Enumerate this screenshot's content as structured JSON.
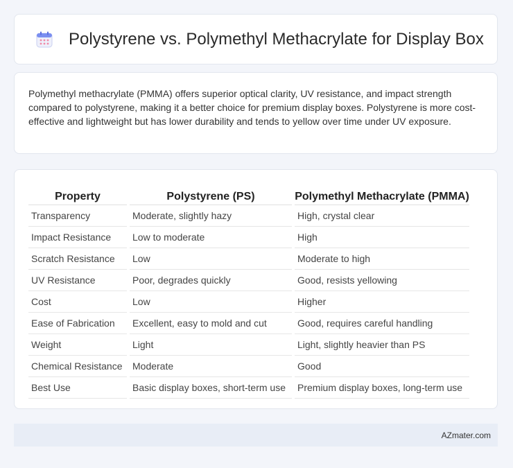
{
  "header": {
    "title": "Polystyrene vs. Polymethyl Methacrylate for Display Box",
    "icon": "calendar-icon"
  },
  "summary": {
    "text": "Polymethyl methacrylate (PMMA) offers superior optical clarity, UV resistance, and impact strength compared to polystyrene, making it a better choice for premium display boxes. Polystyrene is more cost-effective and lightweight but has lower durability and tends to yellow over time under UV exposure."
  },
  "table": {
    "headers": [
      "Property",
      "Polystyrene (PS)",
      "Polymethyl Methacrylate (PMMA)"
    ],
    "rows": [
      [
        "Transparency",
        "Moderate, slightly hazy",
        "High, crystal clear"
      ],
      [
        "Impact Resistance",
        "Low to moderate",
        "High"
      ],
      [
        "Scratch Resistance",
        "Low",
        "Moderate to high"
      ],
      [
        "UV Resistance",
        "Poor, degrades quickly",
        "Good, resists yellowing"
      ],
      [
        "Cost",
        "Low",
        "Higher"
      ],
      [
        "Ease of Fabrication",
        "Excellent, easy to mold and cut",
        "Good, requires careful handling"
      ],
      [
        "Weight",
        "Light",
        "Light, slightly heavier than PS"
      ],
      [
        "Chemical Resistance",
        "Moderate",
        "Good"
      ],
      [
        "Best Use",
        "Basic display boxes, short-term use",
        "Premium display boxes, long-term use"
      ]
    ]
  },
  "footer": {
    "brand": "AZmater.com"
  }
}
